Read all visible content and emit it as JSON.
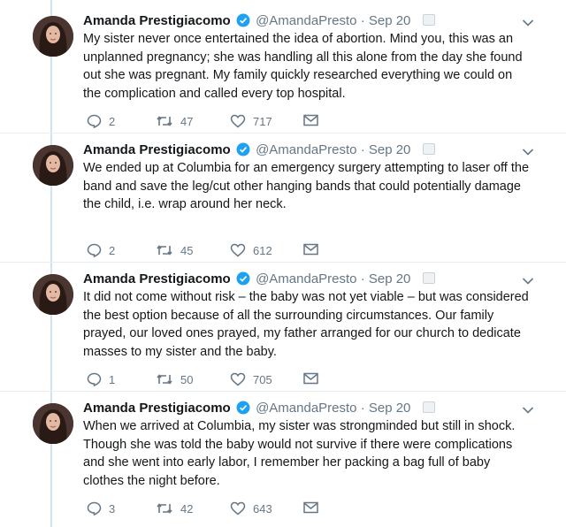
{
  "tweets": [
    {
      "author": {
        "name": "Amanda Prestigiacomo",
        "handle": "@AmandaPresto"
      },
      "separator": "·",
      "date": "Sep 20",
      "text": "My sister never once entertained the idea of abortion. Mind you, this was an unplanned pregnancy; she was handling all this alone from the day she found out she was pregnant. My family quickly researched everything we could on the complication and called every top hospital.",
      "replies": "2",
      "retweets": "47",
      "likes": "717"
    },
    {
      "author": {
        "name": "Amanda Prestigiacomo",
        "handle": "@AmandaPresto"
      },
      "separator": "·",
      "date": "Sep 20",
      "text": "We ended up at Columbia for an emergency surgery attempting to laser off the band and save the leg/cut other hanging bands that could potentially damage the child, i.e. wrap around her neck.",
      "replies": "2",
      "retweets": "45",
      "likes": "612"
    },
    {
      "author": {
        "name": "Amanda Prestigiacomo",
        "handle": "@AmandaPresto"
      },
      "separator": "·",
      "date": "Sep 20",
      "text": "It did not come without risk – the baby was not yet viable – but was considered the best option because of all the surrounding circumstances. Our family prayed, our loved ones prayed, my father arranged for our church to dedicate masses to my sister and the baby.",
      "replies": "1",
      "retweets": "50",
      "likes": "705"
    },
    {
      "author": {
        "name": "Amanda Prestigiacomo",
        "handle": "@AmandaPresto"
      },
      "separator": "·",
      "date": "Sep 20",
      "text": "When we arrived at Columbia, my sister was strongminded but still in shock. Though she was told the baby would not survive if there were complications and she went into early labor, I remember her packing a bag full of baby clothes the night before.",
      "replies": "3",
      "retweets": "42",
      "likes": "643"
    }
  ],
  "icons": {
    "reply": "reply-icon",
    "retweet": "retweet-icon",
    "like": "heart-icon",
    "message": "envelope-icon",
    "verified": "verified-badge-icon",
    "caret": "chevron-down-icon"
  },
  "colors": {
    "verified": "#1da1f2",
    "thread_line": "#cfe3f2",
    "muted": "#657786"
  }
}
